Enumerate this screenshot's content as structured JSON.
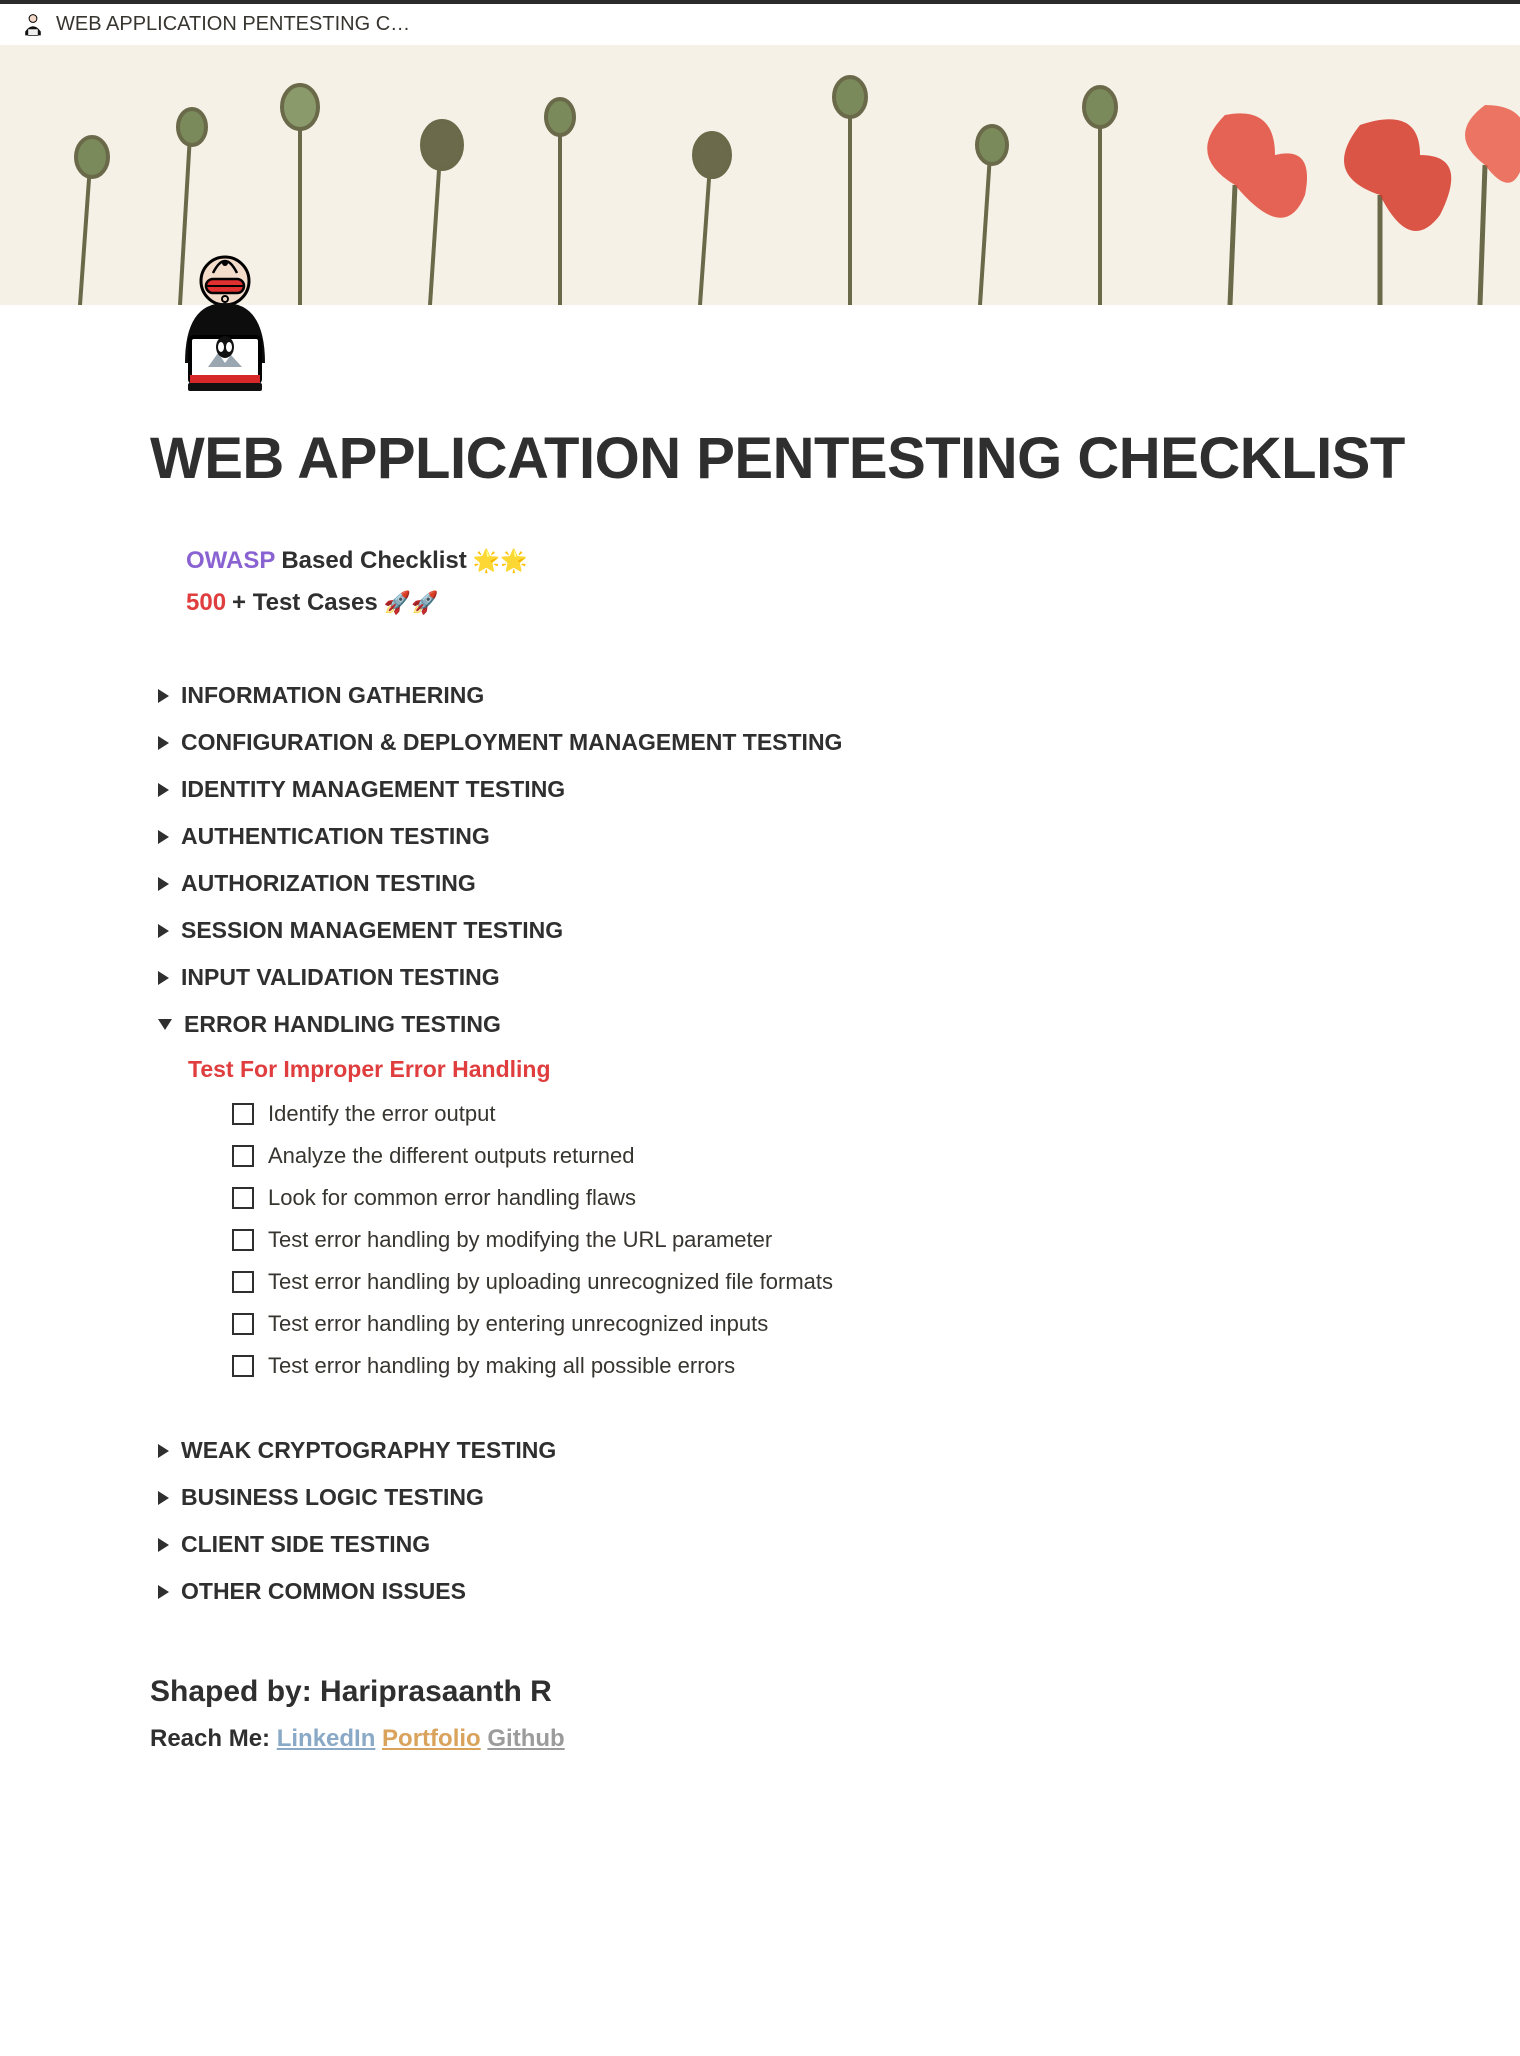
{
  "topbar": {
    "title": "WEB APPLICATION PENTESTING C…"
  },
  "page": {
    "title": "WEB APPLICATION PENTESTING CHECKLIST"
  },
  "intro": {
    "owasp": "OWASP",
    "based": " Based Checklist  ",
    "stars": "🌟🌟",
    "five": "500",
    "plus": "+ Test Cases ",
    "rockets": "🚀🚀"
  },
  "sections": {
    "info": "INFORMATION GATHERING",
    "config": "CONFIGURATION & DEPLOYMENT MANAGEMENT TESTING",
    "identity": "IDENTITY MANAGEMENT TESTING",
    "authn": "AUTHENTICATION TESTING",
    "authz": "AUTHORIZATION TESTING",
    "session": "SESSION MANAGEMENT TESTING",
    "input": "INPUT VALIDATION TESTING",
    "error": "ERROR HANDLING TESTING",
    "crypto": "WEAK CRYPTOGRAPHY TESTING",
    "logic": "BUSINESS LOGIC TESTING",
    "client": "CLIENT SIDE TESTING",
    "other": "OTHER COMMON ISSUES"
  },
  "error_section": {
    "heading": "Test For Improper Error Handling",
    "items": [
      "Identify the error output",
      "Analyze the different outputs returned",
      "Look for common error handling flaws",
      "Test error handling by modifying the URL parameter",
      "Test error handling by uploading unrecognized file formats",
      "Test error handling by entering unrecognized inputs",
      "Test error handling by making all possible errors"
    ]
  },
  "footer": {
    "shaped_prefix": "Shaped by: ",
    "author": "Hariprasaanth R",
    "reach_prefix": "Reach Me: ",
    "linkedin": "LinkedIn",
    "portfolio": "Portfolio",
    "github": "Github"
  }
}
